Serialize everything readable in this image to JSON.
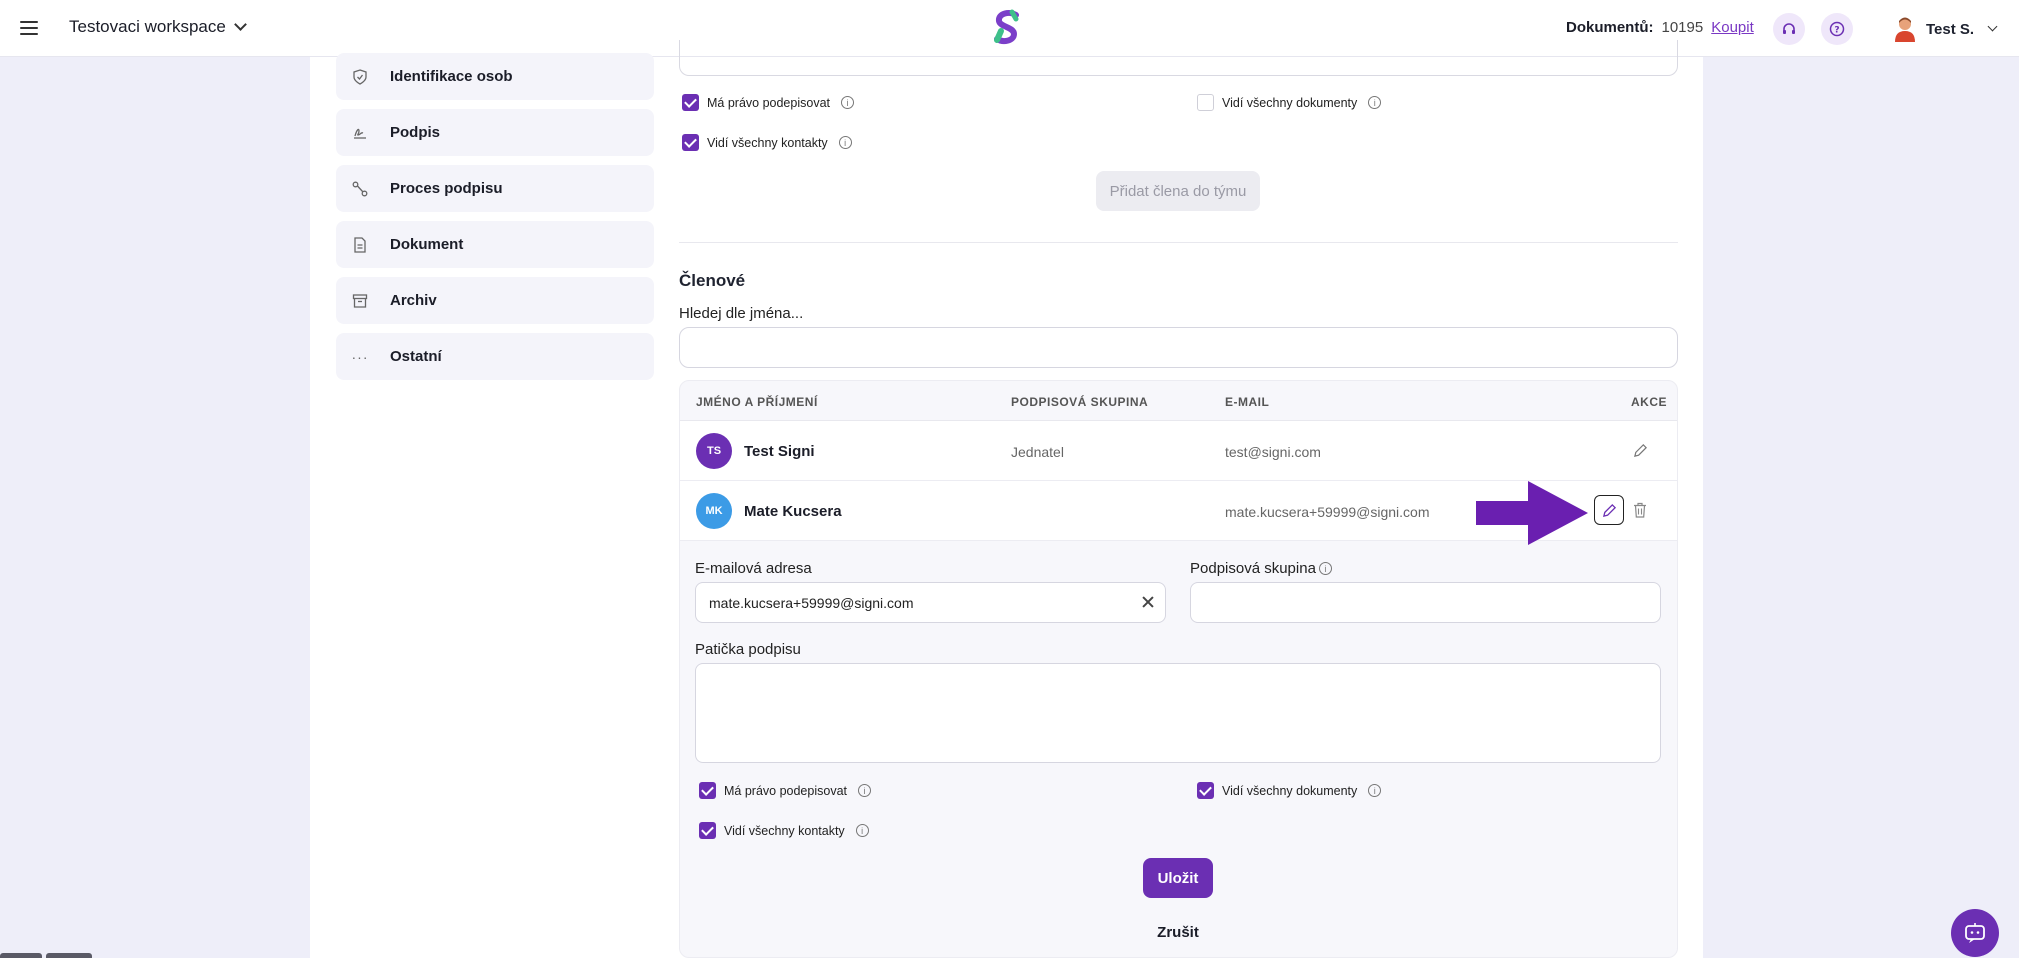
{
  "header": {
    "workspace": "Testovaci workspace",
    "docs_label": "Dokumentů:",
    "docs_count": "10195",
    "buy_link": "Koupit",
    "user_name": "Test S."
  },
  "sidebar": {
    "items": [
      {
        "label": "Identifikace osob",
        "icon": "shield-icon"
      },
      {
        "label": "Podpis",
        "icon": "signature-icon"
      },
      {
        "label": "Proces podpisu",
        "icon": "flow-icon"
      },
      {
        "label": "Dokument",
        "icon": "document-icon"
      },
      {
        "label": "Archiv",
        "icon": "archive-icon"
      },
      {
        "label": "Ostatní",
        "icon": "more-icon"
      }
    ]
  },
  "add_member": {
    "checkboxes": [
      {
        "label": "Má právo podepisovat",
        "checked": true
      },
      {
        "label": "Vidí všechny dokumenty",
        "checked": false
      },
      {
        "label": "Vidí všechny kontakty",
        "checked": true
      }
    ],
    "button": "Přidat člena do týmu"
  },
  "members": {
    "title": "Členové",
    "search_label": "Hledej dle jména...",
    "columns": [
      "JMÉNO A PŘÍJMENÍ",
      "PODPISOVÁ SKUPINA",
      "E-MAIL",
      "AKCE"
    ],
    "rows": [
      {
        "initials": "TS",
        "name": "Test Signi",
        "group": "Jednatel",
        "email": "test@signi.com",
        "avatar_color": "#6b2fb3"
      },
      {
        "initials": "MK",
        "name": "Mate Kucsera",
        "group": "",
        "email": "mate.kucsera+59999@signi.com",
        "avatar_color": "#3c9be6"
      }
    ]
  },
  "edit_form": {
    "email_label": "E-mailová adresa",
    "email_value": "mate.kucsera+59999@signi.com",
    "group_label": "Podpisová skupina",
    "group_value": "",
    "footer_label": "Patička podpisu",
    "checkboxes": [
      {
        "label": "Má právo podepisovat",
        "checked": true
      },
      {
        "label": "Vidí všechny dokumenty",
        "checked": true
      },
      {
        "label": "Vidí všechny kontakty",
        "checked": true
      }
    ],
    "save": "Uložit",
    "cancel": "Zrušit"
  },
  "colors": {
    "accent": "#6b2fb3",
    "background": "#eeeef9"
  }
}
